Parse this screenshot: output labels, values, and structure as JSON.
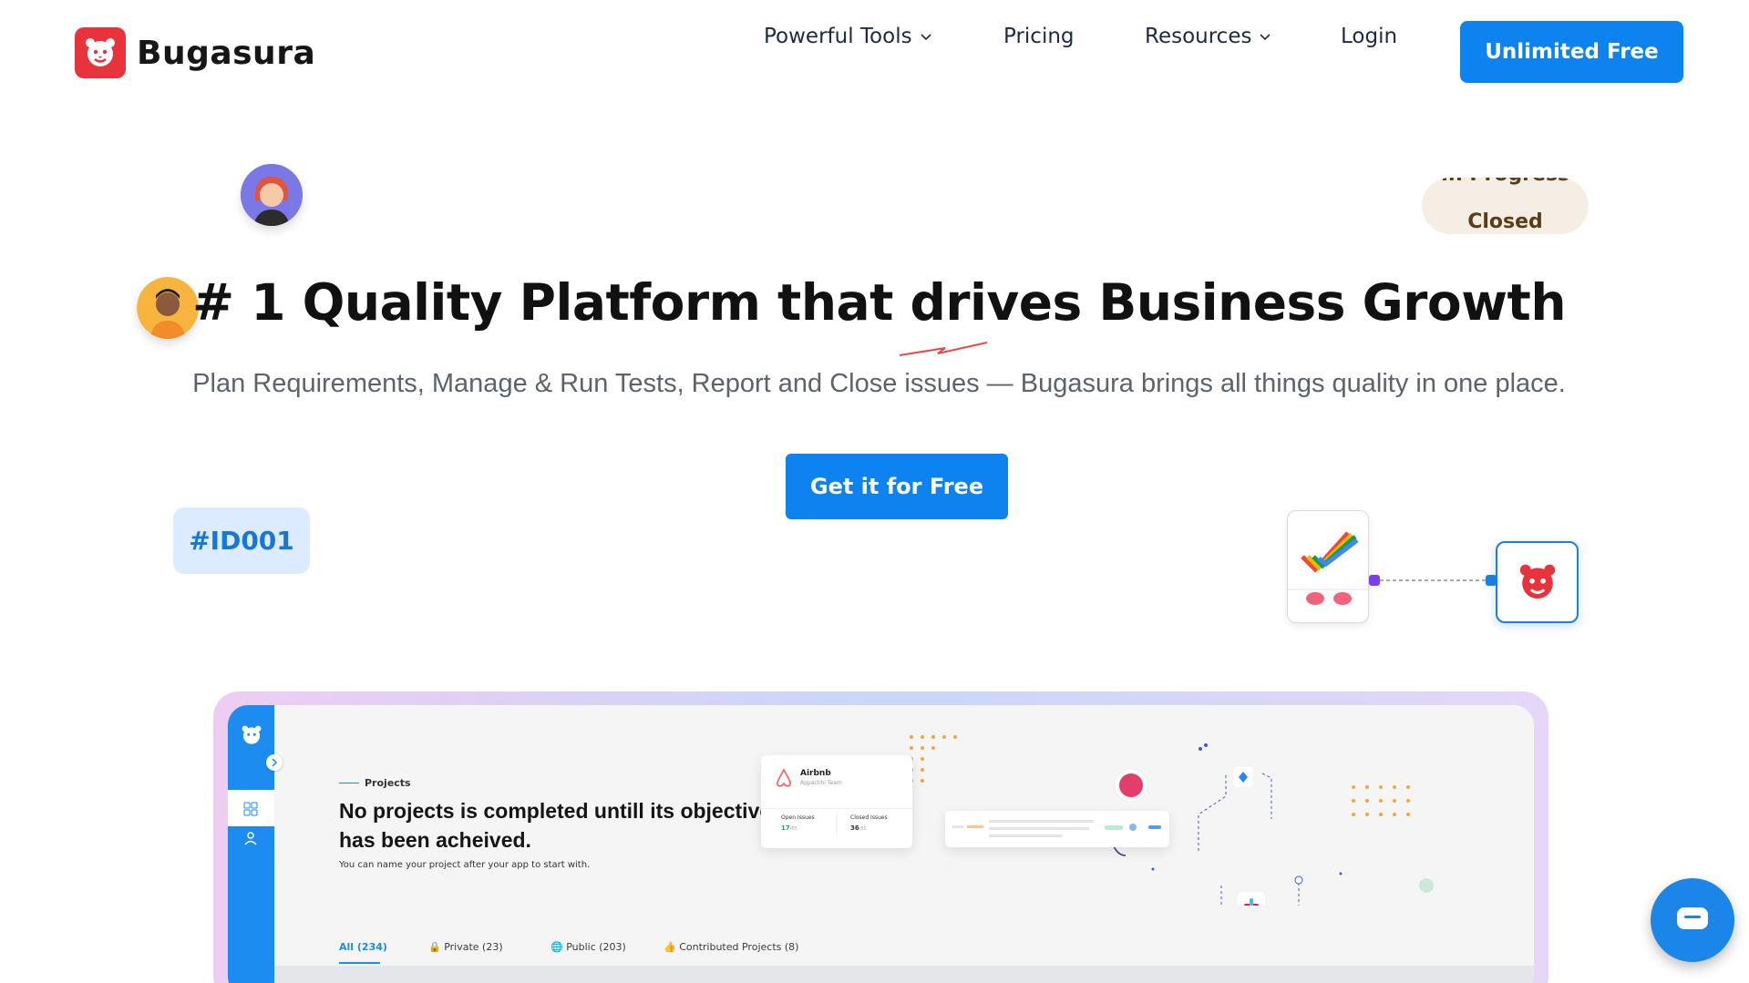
{
  "brand": {
    "name": "Bugasura"
  },
  "nav": {
    "items": [
      {
        "label": "Powerful Tools",
        "dropdown": true
      },
      {
        "label": "Pricing",
        "dropdown": false
      },
      {
        "label": "Resources",
        "dropdown": true
      },
      {
        "label": "Login",
        "dropdown": false
      }
    ],
    "cta": "Unlimited Free"
  },
  "hero": {
    "title": "# 1 Quality Platform that drives Business Growth",
    "subtitle": "Plan Requirements, Manage & Run Tests, Report and Close issues — Bugasura brings all things quality in one place.",
    "cta": "Get it for Free"
  },
  "floating": {
    "tag_id": "#ID001",
    "status_prev": "In Progress",
    "status_current": "Closed"
  },
  "preview": {
    "section_label": "Projects",
    "title": "No projects is completed untill its objective has been acheived.",
    "description": "You can name your project after your app to start with.",
    "tabs": [
      {
        "label": "All (234)",
        "active": true
      },
      {
        "label": "Private (23)",
        "active": false
      },
      {
        "label": "Public (203)",
        "active": false
      },
      {
        "label": "Contributed Projects (8)",
        "active": false
      }
    ],
    "card": {
      "name": "Airbnb",
      "team": "Appachhi Team",
      "open_label": "Open Issues",
      "open_value": "17",
      "open_total": "/65",
      "closed_label": "Closed Issues",
      "closed_value": "36",
      "closed_total": "/65"
    }
  },
  "colors": {
    "accent": "#0d83f0",
    "brand_red": "#e8323c",
    "tag_bg": "#dcebff",
    "status_bg": "#f5eee4"
  }
}
